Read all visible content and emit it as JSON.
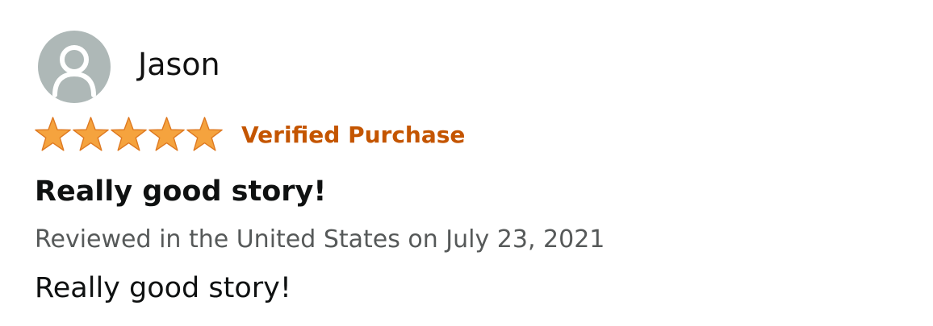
{
  "review": {
    "profile": {
      "name": "Jason",
      "avatar_icon": "user-silhouette-icon"
    },
    "rating": {
      "stars": 5,
      "max_stars": 5,
      "star_color": "#f5a33e",
      "star_icon": "star-icon"
    },
    "verified_label": "Verified Purchase",
    "verified_color": "#c45500",
    "title": "Really good story!",
    "date_line": "Reviewed in the United States on July 23, 2021",
    "body": "Really good story!"
  }
}
